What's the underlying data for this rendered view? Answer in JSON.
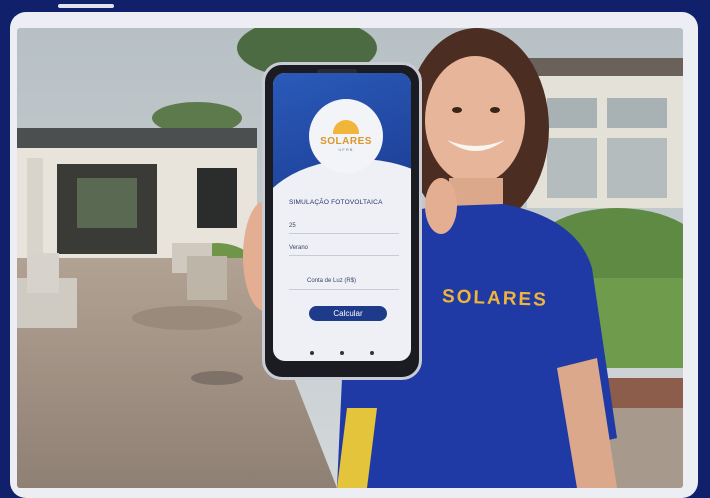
{
  "photo": {
    "scene": "student-holding-phone-app",
    "colors": {
      "background": "#10206b",
      "frame": "#eceef3",
      "shirt": "#1f3aa5",
      "accent": "#f0b43a"
    }
  },
  "app": {
    "logo_text": "SOLARES",
    "logo_sub": "UFRB",
    "title": "SIMULAÇÃO FOTOVOLTAICA",
    "field_1_value": "25",
    "field_2_value": "Verano",
    "field_3_label": "Conta de Luz (R$)",
    "button_label": "Calcular"
  },
  "shirt": {
    "text": "SOLARES"
  }
}
